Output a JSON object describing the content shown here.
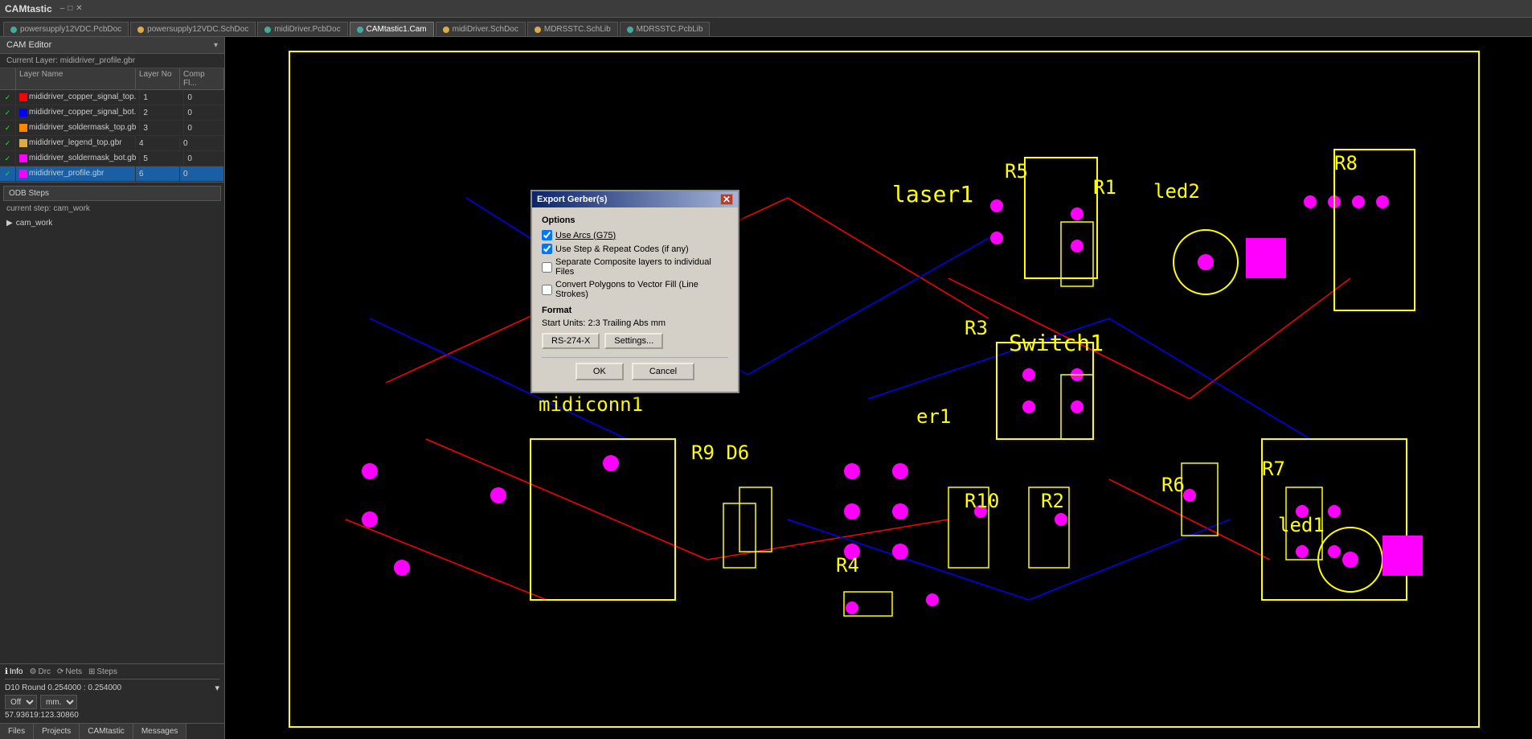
{
  "app": {
    "title": "CAMtastic"
  },
  "tabs": [
    {
      "id": "powersupply12VDC-pcb",
      "label": "powersupply12VDC.PcbDoc",
      "dot_color": "#4a9",
      "active": false
    },
    {
      "id": "powersupply12VDC-sch",
      "label": "powersupply12VDC.SchDoc",
      "dot_color": "#da4",
      "active": false
    },
    {
      "id": "midiDriver-pcb",
      "label": "midiDriver.PcbDoc",
      "dot_color": "#4a9",
      "active": false
    },
    {
      "id": "camtastic",
      "label": "CAMtastic1.Cam",
      "dot_color": "#4a9",
      "active": true
    },
    {
      "id": "midiDriver-sch",
      "label": "midiDriver.SchDoc",
      "dot_color": "#da4",
      "active": false
    },
    {
      "id": "MDRSSTC-sch",
      "label": "MDRSSTC.SchLib",
      "dot_color": "#da4",
      "active": false
    },
    {
      "id": "MDRSSTC-pcb",
      "label": "MDRSSTC.PcbLib",
      "dot_color": "#4a9",
      "active": false
    }
  ],
  "left_panel": {
    "cam_editor_label": "CAM Editor",
    "current_layer_label": "Current Layer: mididriver_profile.gbr",
    "layer_table": {
      "headers": [
        "",
        "Layer Name",
        "Layer No",
        "Comp Fl..."
      ],
      "rows": [
        {
          "checked": true,
          "color": "#f00",
          "name": "mididriver_copper_signal_top.",
          "layer_no": "1",
          "comp_fl": "0"
        },
        {
          "checked": true,
          "color": "#00f",
          "name": "mididriver_copper_signal_bot.",
          "layer_no": "2",
          "comp_fl": "0"
        },
        {
          "checked": true,
          "color": "#f80",
          "name": "mididriver_soldermask_top.gb",
          "layer_no": "3",
          "comp_fl": "0"
        },
        {
          "checked": true,
          "color": "#f80",
          "name": "mididriver_legend_top.gbr",
          "layer_no": "4",
          "comp_fl": "0"
        },
        {
          "checked": true,
          "color": "#f0f",
          "name": "mididriver_soldermask_bot.gb",
          "layer_no": "5",
          "comp_fl": "0"
        },
        {
          "checked": true,
          "color": "#f0f",
          "name": "mididriver_profile.gbr",
          "layer_no": "6",
          "comp_fl": "0",
          "selected": true
        }
      ]
    },
    "odb_steps": {
      "header": "ODB Steps",
      "current_step_label": "current step: cam_work",
      "tree_item": "cam_work"
    },
    "bottom_tabs": [
      {
        "label": "Info",
        "icon": "ℹ",
        "active": true
      },
      {
        "label": "Drc",
        "icon": "⚙",
        "active": false
      },
      {
        "label": "Nets",
        "icon": "⟳",
        "active": false
      },
      {
        "label": "Steps",
        "icon": "⊞",
        "active": false
      }
    ],
    "info_shape": "D10  Round  0.254000 : 0.254000",
    "info_off": "Off",
    "info_unit": "mm.",
    "info_pos": "57.93619:123.30860"
  },
  "nav_footer": [
    {
      "label": "Files"
    },
    {
      "label": "Projects"
    },
    {
      "label": "CAMtastic"
    },
    {
      "label": "Messages"
    }
  ],
  "dialog": {
    "title": "Export Gerber(s)",
    "options_label": "Options",
    "checkbox1_label": "Use Arcs (G75)",
    "checkbox1_checked": true,
    "checkbox2_label": "Use Step & Repeat Codes (if any)",
    "checkbox2_checked": true,
    "checkbox3_label": "Separate Composite layers to individual Files",
    "checkbox3_checked": false,
    "checkbox4_label": "Convert Polygons to Vector Fill (Line Strokes)",
    "checkbox4_checked": false,
    "format_label": "Format",
    "start_units_label": "Start Units: 2:3 Trailing Abs mm",
    "btn_rs274x_label": "RS-274-X",
    "btn_settings_label": "Settings...",
    "ok_label": "OK",
    "cancel_label": "Cancel"
  }
}
